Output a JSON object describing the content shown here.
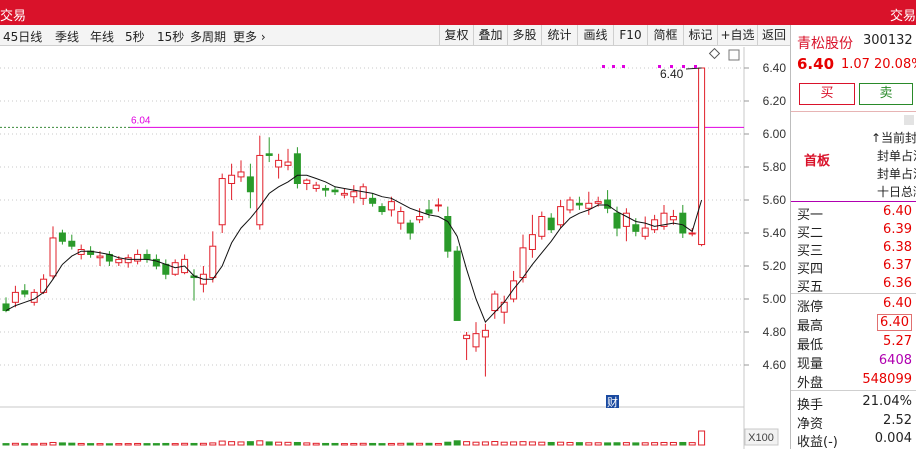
{
  "window": {
    "title_left": "交易",
    "title_right": "交易"
  },
  "toolbar": {
    "periods": [
      "45日线",
      "季线",
      "年线",
      "5秒",
      "15秒",
      "多周期",
      "更多 ›"
    ],
    "buttons": [
      "复权",
      "叠加",
      "多股",
      "统计",
      "画线",
      "F10",
      "简框",
      "标记",
      "+自选",
      "返回"
    ]
  },
  "chart": {
    "price_axis": [
      "6.40",
      "6.20",
      "6.00",
      "5.80",
      "5.60",
      "5.40",
      "5.20",
      "5.00",
      "4.80",
      "4.60"
    ],
    "reference_line": {
      "label": "6.04",
      "value": 6.04,
      "color": "#e000e0"
    },
    "high_marker": "6.40",
    "fin_badge": "财",
    "volume_scale": "X100",
    "up_color": "#e0202a",
    "down_color": "#2a9a2a",
    "candles": [
      [
        4.97,
        4.93,
        5.01,
        4.92
      ],
      [
        4.98,
        5.04,
        5.08,
        4.95
      ],
      [
        5.05,
        5.03,
        5.09,
        5.01
      ],
      [
        4.98,
        5.04,
        5.06,
        4.96
      ],
      [
        5.04,
        5.12,
        5.15,
        5.03
      ],
      [
        5.14,
        5.37,
        5.44,
        5.12
      ],
      [
        5.4,
        5.35,
        5.42,
        5.33
      ],
      [
        5.35,
        5.32,
        5.39,
        5.3
      ],
      [
        5.27,
        5.3,
        5.33,
        5.24
      ],
      [
        5.29,
        5.27,
        5.32,
        5.25
      ],
      [
        5.25,
        5.26,
        5.29,
        5.2
      ],
      [
        5.27,
        5.23,
        5.29,
        5.2
      ],
      [
        5.22,
        5.24,
        5.26,
        5.2
      ],
      [
        5.22,
        5.25,
        5.27,
        5.19
      ],
      [
        5.23,
        5.27,
        5.3,
        5.21
      ],
      [
        5.27,
        5.24,
        5.3,
        5.22
      ],
      [
        5.24,
        5.2,
        5.27,
        5.18
      ],
      [
        5.21,
        5.15,
        5.24,
        5.12
      ],
      [
        5.15,
        5.22,
        5.24,
        5.14
      ],
      [
        5.16,
        5.24,
        5.27,
        5.15
      ],
      [
        5.14,
        5.13,
        5.18,
        4.99
      ],
      [
        5.09,
        5.15,
        5.2,
        5.04
      ],
      [
        5.13,
        5.32,
        5.41,
        5.1
      ],
      [
        5.45,
        5.73,
        5.76,
        5.4
      ],
      [
        5.7,
        5.75,
        5.82,
        5.6
      ],
      [
        5.74,
        5.77,
        5.84,
        5.71
      ],
      [
        5.74,
        5.65,
        5.82,
        5.55
      ],
      [
        5.45,
        5.87,
        5.99,
        5.42
      ],
      [
        5.88,
        5.87,
        5.98,
        5.83
      ],
      [
        5.8,
        5.84,
        5.88,
        5.73
      ],
      [
        5.81,
        5.83,
        5.91,
        5.78
      ],
      [
        5.88,
        5.7,
        5.92,
        5.67
      ],
      [
        5.7,
        5.72,
        5.73,
        5.66
      ],
      [
        5.67,
        5.69,
        5.71,
        5.65
      ],
      [
        5.67,
        5.66,
        5.69,
        5.62
      ],
      [
        5.66,
        5.65,
        5.68,
        5.63
      ],
      [
        5.63,
        5.64,
        5.67,
        5.61
      ],
      [
        5.62,
        5.65,
        5.69,
        5.58
      ],
      [
        5.61,
        5.68,
        5.7,
        5.57
      ],
      [
        5.61,
        5.58,
        5.64,
        5.56
      ],
      [
        5.56,
        5.53,
        5.58,
        5.51
      ],
      [
        5.54,
        5.59,
        5.62,
        5.5
      ],
      [
        5.46,
        5.53,
        5.56,
        5.42
      ],
      [
        5.46,
        5.4,
        5.48,
        5.36
      ],
      [
        5.48,
        5.5,
        5.55,
        5.46
      ],
      [
        5.54,
        5.52,
        5.6,
        5.49
      ],
      [
        5.57,
        5.57,
        5.61,
        5.53
      ],
      [
        5.5,
        5.29,
        5.56,
        5.25
      ],
      [
        5.29,
        4.87,
        5.32,
        4.87
      ],
      [
        4.76,
        4.78,
        4.8,
        4.63
      ],
      [
        4.71,
        4.79,
        4.86,
        4.68
      ],
      [
        4.77,
        4.81,
        4.85,
        4.53
      ],
      [
        4.93,
        5.03,
        5.05,
        4.88
      ],
      [
        4.92,
        4.98,
        5.02,
        4.85
      ],
      [
        5.0,
        5.11,
        5.17,
        4.98
      ],
      [
        5.13,
        5.31,
        5.39,
        5.1
      ],
      [
        5.3,
        5.39,
        5.51,
        5.25
      ],
      [
        5.38,
        5.5,
        5.53,
        5.36
      ],
      [
        5.49,
        5.42,
        5.52,
        5.4
      ],
      [
        5.45,
        5.56,
        5.6,
        5.43
      ],
      [
        5.54,
        5.6,
        5.62,
        5.52
      ],
      [
        5.58,
        5.57,
        5.62,
        5.54
      ],
      [
        5.55,
        5.58,
        5.65,
        5.51
      ],
      [
        5.58,
        5.59,
        5.62,
        5.56
      ],
      [
        5.6,
        5.55,
        5.66,
        5.52
      ],
      [
        5.52,
        5.43,
        5.56,
        5.38
      ],
      [
        5.44,
        5.52,
        5.55,
        5.35
      ],
      [
        5.45,
        5.41,
        5.49,
        5.38
      ],
      [
        5.38,
        5.43,
        5.5,
        5.36
      ],
      [
        5.42,
        5.48,
        5.51,
        5.4
      ],
      [
        5.44,
        5.52,
        5.57,
        5.42
      ],
      [
        5.48,
        5.5,
        5.54,
        5.45
      ],
      [
        5.52,
        5.4,
        5.57,
        5.37
      ],
      [
        5.4,
        5.4,
        5.43,
        5.38
      ],
      [
        5.33,
        6.4,
        6.4,
        5.32
      ]
    ],
    "ma": [
      4.93,
      4.96,
      4.98,
      5.0,
      5.04,
      5.12,
      5.21,
      5.26,
      5.29,
      5.29,
      5.28,
      5.27,
      5.25,
      5.24,
      5.24,
      5.24,
      5.23,
      5.21,
      5.19,
      5.2,
      5.14,
      5.12,
      5.12,
      5.2,
      5.34,
      5.43,
      5.49,
      5.56,
      5.64,
      5.68,
      5.71,
      5.75,
      5.75,
      5.73,
      5.71,
      5.68,
      5.67,
      5.66,
      5.65,
      5.64,
      5.62,
      5.61,
      5.58,
      5.55,
      5.53,
      5.51,
      5.5,
      5.47,
      5.38,
      5.18,
      5.0,
      4.86,
      4.92,
      4.98,
      5.06,
      5.13,
      5.21,
      5.28,
      5.35,
      5.43,
      5.49,
      5.52,
      5.54,
      5.57,
      5.57,
      5.53,
      5.5,
      5.47,
      5.46,
      5.44,
      5.45,
      5.46,
      5.45,
      5.41,
      5.6
    ],
    "volume": [
      0.1,
      0.12,
      0.1,
      0.09,
      0.12,
      0.18,
      0.15,
      0.13,
      0.11,
      0.1,
      0.1,
      0.09,
      0.1,
      0.1,
      0.11,
      0.1,
      0.1,
      0.11,
      0.1,
      0.12,
      0.11,
      0.12,
      0.15,
      0.28,
      0.24,
      0.22,
      0.24,
      0.3,
      0.22,
      0.2,
      0.19,
      0.18,
      0.15,
      0.12,
      0.11,
      0.11,
      0.1,
      0.11,
      0.12,
      0.11,
      0.1,
      0.11,
      0.12,
      0.13,
      0.12,
      0.12,
      0.11,
      0.2,
      0.3,
      0.24,
      0.2,
      0.22,
      0.25,
      0.2,
      0.22,
      0.24,
      0.22,
      0.2,
      0.18,
      0.2,
      0.18,
      0.17,
      0.16,
      0.16,
      0.15,
      0.16,
      0.17,
      0.15,
      0.16,
      0.17,
      0.18,
      0.18,
      0.18,
      0.17,
      1.0
    ]
  },
  "quote": {
    "name": "青松股份",
    "code": "300132",
    "price": "6.40",
    "change": "1.07",
    "change_pct": "20.08%",
    "buy_label": "买",
    "sell_label": "卖",
    "first_board": "首板",
    "seal_lines": [
      "↑当前封单",
      "封单占流",
      "封单占流",
      "十日总涨"
    ],
    "bids": [
      {
        "label": "买一",
        "value": "6.40"
      },
      {
        "label": "买二",
        "value": "6.39"
      },
      {
        "label": "买三",
        "value": "6.38"
      },
      {
        "label": "买四",
        "value": "6.37"
      },
      {
        "label": "买五",
        "value": "6.36"
      }
    ],
    "stats": [
      {
        "label": "涨停",
        "value": "6.40"
      },
      {
        "label": "最高",
        "value": "6.40"
      },
      {
        "label": "最低",
        "value": "5.27"
      },
      {
        "label": "现量",
        "value": "6408"
      },
      {
        "label": "外盘",
        "value": "548099"
      }
    ],
    "stats2": [
      {
        "label": "换手",
        "value": "21.04%"
      },
      {
        "label": "净资",
        "value": "2.52"
      },
      {
        "label": "收益(-)",
        "value": "0.004"
      }
    ]
  }
}
